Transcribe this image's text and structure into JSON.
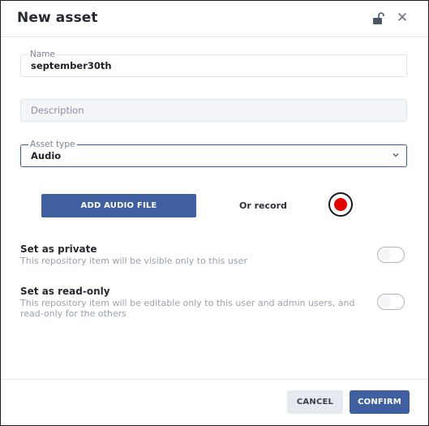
{
  "dialog": {
    "title": "New asset",
    "lock_icon": "lock-open-icon",
    "close_icon": "close-icon",
    "close_glyph": "✕"
  },
  "fields": {
    "name": {
      "label": "Name",
      "value": "september30th"
    },
    "description": {
      "placeholder": "Description"
    },
    "asset_type": {
      "label": "Asset type",
      "value": "Audio",
      "icon": "chevron-down-icon"
    }
  },
  "audio": {
    "add_label": "ADD AUDIO FILE",
    "or_record": "Or record",
    "record_icon": "record-icon",
    "record_color": "#e10600"
  },
  "settings": {
    "private": {
      "title": "Set as private",
      "description": "This repository item will be visible only to this user",
      "enabled": false
    },
    "readonly": {
      "title": "Set as read-only",
      "description": "This repository item will be editable only to this user and admin users, and read-only for the others",
      "enabled": false
    }
  },
  "footer": {
    "cancel_label": "CANCEL",
    "confirm_label": "CONFIRM"
  },
  "colors": {
    "primary": "#3f5fa0",
    "secondary_button": "#e6e9ef",
    "border": "#dfe3ea"
  }
}
